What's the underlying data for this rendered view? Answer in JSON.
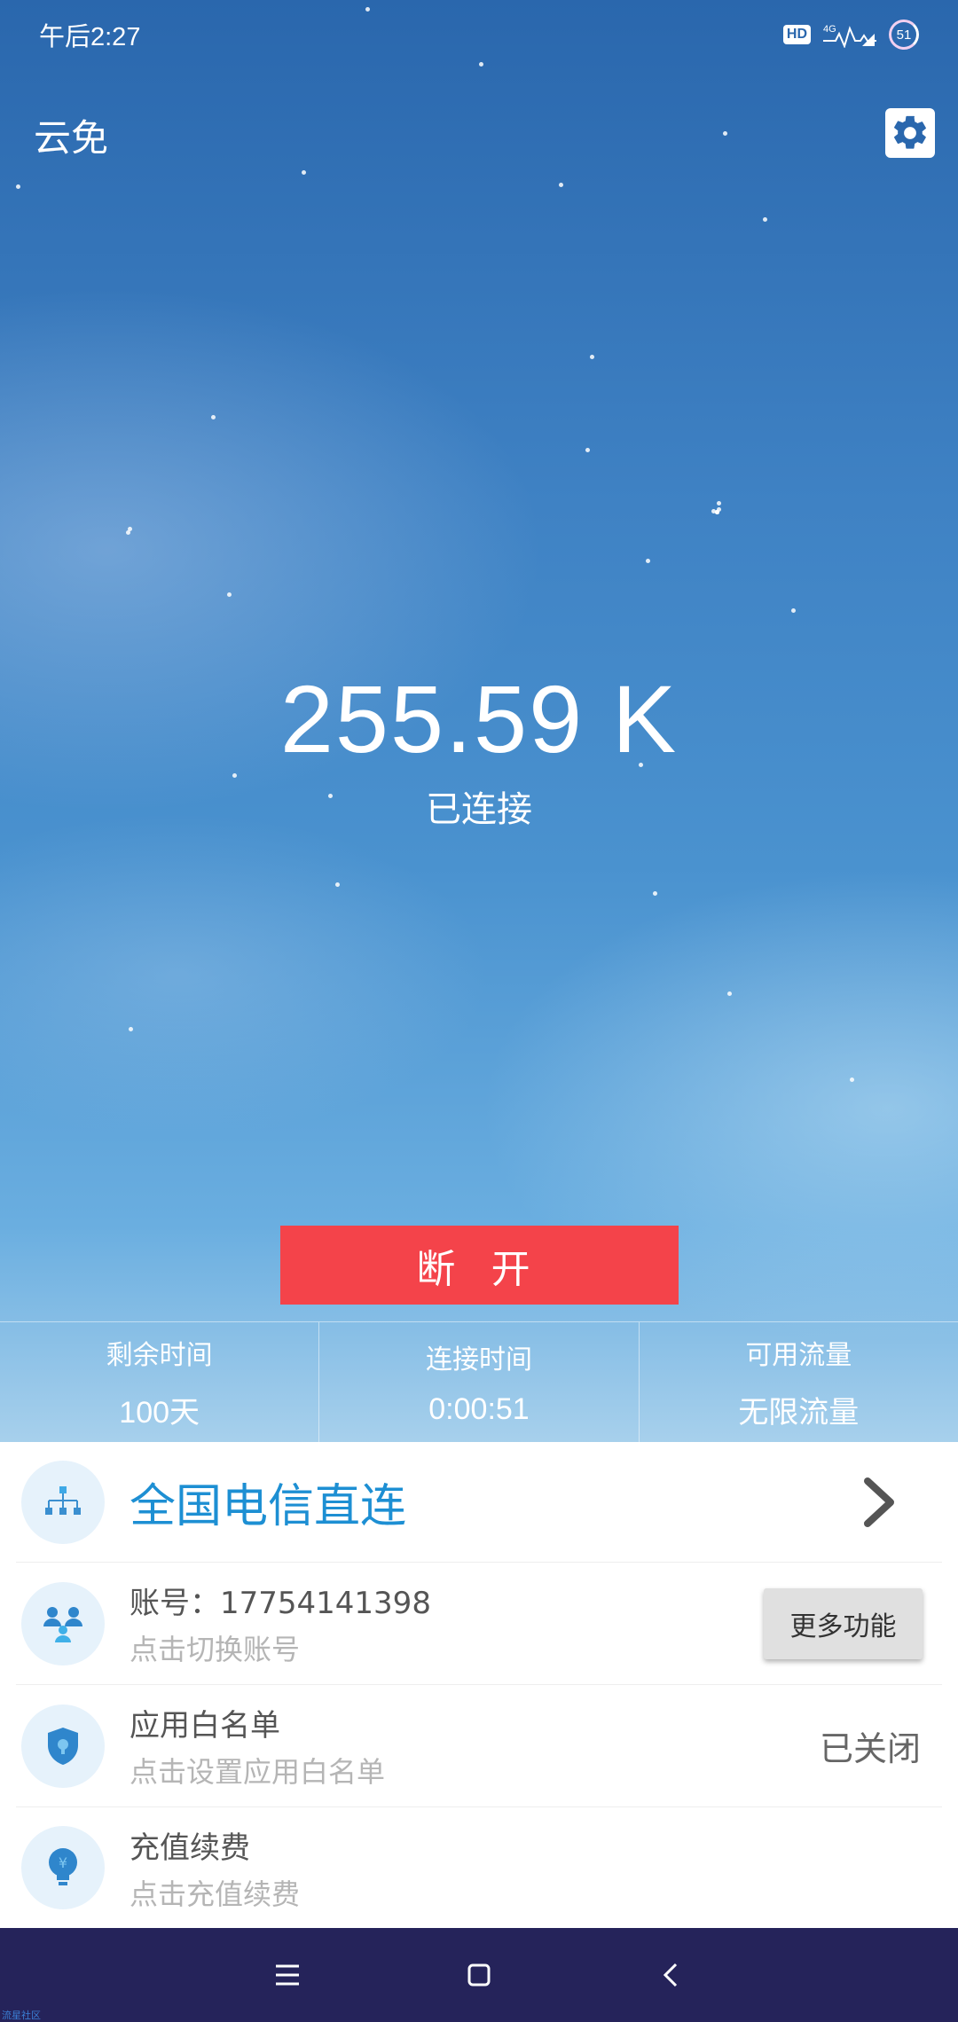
{
  "status_bar": {
    "time": "午后2:27",
    "hd_label": "HD",
    "network_label": "4G",
    "battery": "51"
  },
  "header": {
    "app_title": "云免",
    "settings_icon": "gear-icon"
  },
  "connection": {
    "speed": "255.59 K",
    "status": "已连接",
    "disconnect_label": "断 开"
  },
  "stats": [
    {
      "label": "剩余时间",
      "value": "100天"
    },
    {
      "label": "连接时间",
      "value": "0:00:51"
    },
    {
      "label": "可用流量",
      "value": "无限流量"
    }
  ],
  "list": {
    "route": {
      "title": "全国电信直连",
      "icon": "network-tree-icon"
    },
    "account": {
      "title": "账号：17754141398",
      "subtitle": "点击切换账号",
      "button": "更多功能",
      "icon": "users-icon"
    },
    "whitelist": {
      "title": "应用白名单",
      "subtitle": "点击设置应用白名单",
      "state": "已关闭",
      "icon": "shield-icon"
    },
    "recharge": {
      "title": "充值续费",
      "subtitle": "点击充值续费",
      "icon": "yuan-bulb-icon"
    }
  },
  "nav": {
    "menu_icon": "menu-icon",
    "home_icon": "home-icon",
    "back_icon": "back-icon"
  },
  "watermark": "流星社区",
  "colors": {
    "accent_blue": "#1d8fd3",
    "disconnect_red": "#f4434a",
    "nav_bg": "#25235a"
  }
}
